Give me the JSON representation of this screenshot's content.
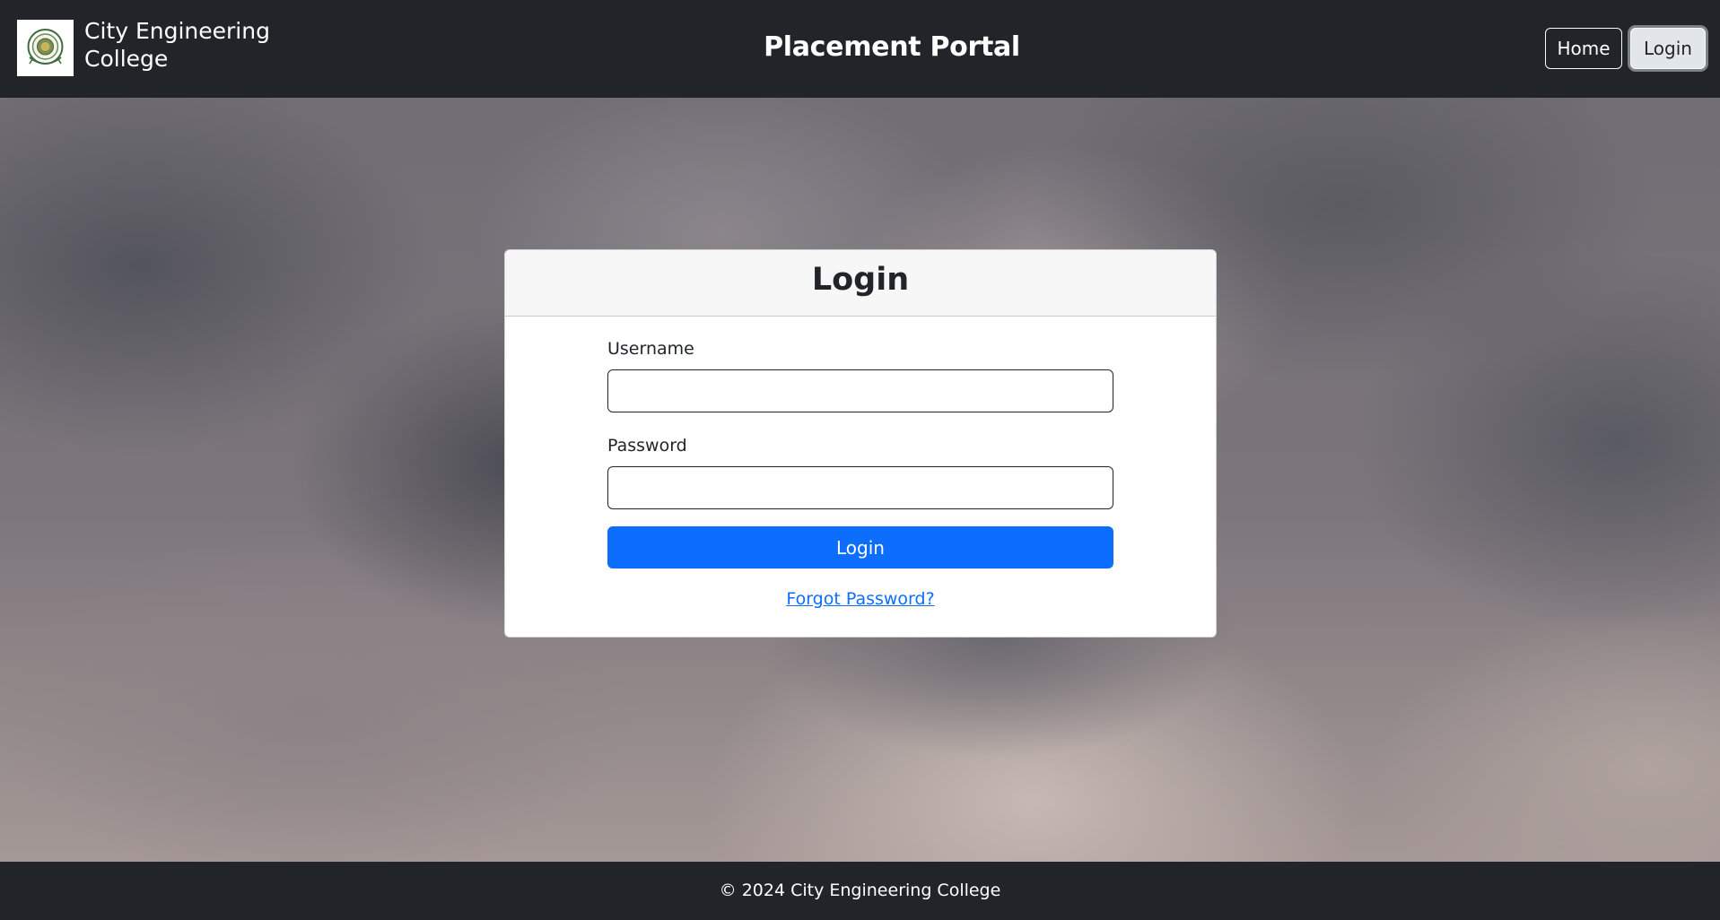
{
  "header": {
    "logo_icon": "college-seal-icon",
    "brand_name": "City Engineering College",
    "title": "Placement Portal",
    "nav": {
      "home_label": "Home",
      "login_label": "Login"
    }
  },
  "login_form": {
    "title": "Login",
    "username_label": "Username",
    "username_value": "",
    "password_label": "Password",
    "password_value": "",
    "submit_label": "Login",
    "forgot_password_label": "Forgot Password?"
  },
  "footer": {
    "text": "© 2024 City Engineering College"
  },
  "colors": {
    "navbar_bg": "#212529",
    "primary": "#0d6efd",
    "card_header_bg": "#f7f7f7"
  }
}
